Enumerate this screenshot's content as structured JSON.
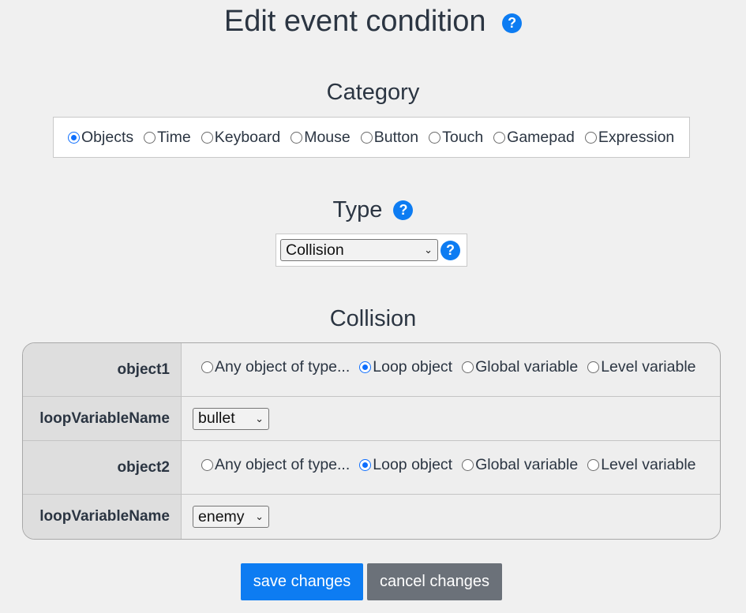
{
  "title": "Edit event condition",
  "help_glyph": "?",
  "category": {
    "heading": "Category",
    "options": [
      "Objects",
      "Time",
      "Keyboard",
      "Mouse",
      "Button",
      "Touch",
      "Gamepad",
      "Expression"
    ],
    "selected": "Objects"
  },
  "type": {
    "heading": "Type",
    "selected_value": "Collision"
  },
  "collision": {
    "heading": "Collision",
    "object_choices": [
      "Any object of type...",
      "Loop object",
      "Global variable",
      "Level variable"
    ],
    "rows": [
      {
        "label": "object1",
        "selected": "Loop object"
      },
      {
        "label": "loopVariableName",
        "value": "bullet"
      },
      {
        "label": "object2",
        "selected": "Loop object"
      },
      {
        "label": "loopVariableName",
        "value": "enemy"
      }
    ]
  },
  "buttons": {
    "save": "save changes",
    "cancel": "cancel changes"
  },
  "colors": {
    "accent": "#0d7cf2",
    "cancel": "#6b7179",
    "background": "#f0f0f0"
  }
}
